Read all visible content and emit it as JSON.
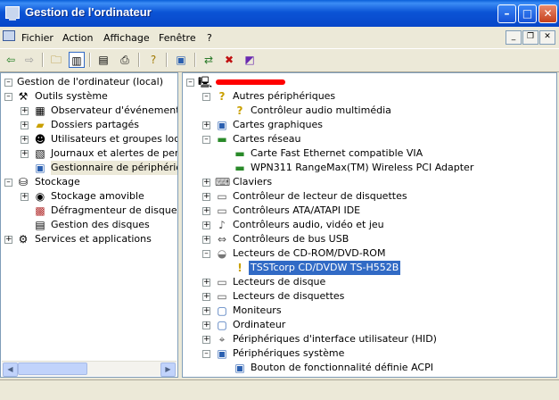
{
  "window": {
    "title": "Gestion de l'ordinateur"
  },
  "menu": {
    "items": [
      "Fichier",
      "Action",
      "Affichage",
      "Fenêtre",
      "?"
    ]
  },
  "toolbar": {
    "buttons": [
      "back-arrow-icon",
      "forward-arrow-icon",
      "up-folder-icon",
      "show-hide-tree-icon",
      "properties-icon",
      "print-icon",
      "help-icon",
      "scan-hardware-icon",
      "update-driver-icon",
      "disable-device-icon",
      "uninstall-device-icon"
    ]
  },
  "left_tree": {
    "root": "Gestion de l'ordinateur (local)",
    "outils": "Outils système",
    "observateur": "Observateur d'événements",
    "dossiers": "Dossiers partagés",
    "utilisateurs": "Utilisateurs et groupes locau:",
    "journaux": "Journaux et alertes de perfo",
    "gestionnaire": "Gestionnaire de périphérique",
    "stockage": "Stockage",
    "amovible": "Stockage amovible",
    "defrag": "Défragmenteur de disque",
    "disques": "Gestion des disques",
    "services": "Services et applications"
  },
  "right_tree": {
    "autres": "Autres périphériques",
    "controleur_audio": "Contrôleur audio multimédia",
    "cartes_graphiques": "Cartes graphiques",
    "cartes_reseau": "Cartes réseau",
    "carte_fast": "Carte Fast Ethernet compatible VIA",
    "wpn": "WPN311 RangeMax(TM) Wireless PCI Adapter",
    "claviers": "Claviers",
    "ctrl_disquettes": "Contrôleur de lecteur de disquettes",
    "ctrl_ata": "Contrôleurs ATA/ATAPI IDE",
    "ctrl_audio_video": "Contrôleurs audio, vidéo et jeu",
    "ctrl_usb": "Contrôleurs de bus USB",
    "lecteurs_cd": "Lecteurs de CD-ROM/DVD-ROM",
    "tsstcorp": "TSSTcorp CD/DVDW TS-H552B",
    "lecteurs_disque": "Lecteurs de disque",
    "lecteurs_disquettes": "Lecteurs de disquettes",
    "moniteurs": "Moniteurs",
    "ordinateur": "Ordinateur",
    "hid": "Périphériques d'interface utilisateur (HID)",
    "systeme": "Périphériques système",
    "acpi": "Bouton de fonctionnalité définie ACPI"
  }
}
